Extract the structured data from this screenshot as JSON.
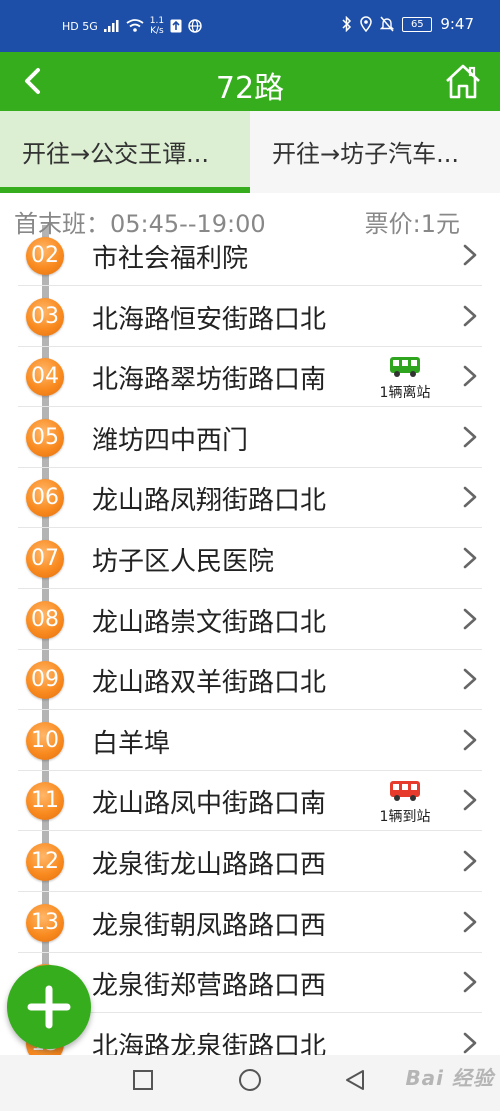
{
  "status_bar": {
    "network": "HD 5G",
    "speed_value": "1.1",
    "speed_unit": "K/s",
    "battery": "65",
    "time": "9:47"
  },
  "header": {
    "title": "72路",
    "back_icon": "chevron-left-icon",
    "home_icon": "home-icon"
  },
  "tabs": [
    {
      "label": "开往→公交王谭...",
      "active": true
    },
    {
      "label": "开往→坊子汽车...",
      "active": false
    }
  ],
  "info": {
    "schedule": "首末班：05:45--19:00",
    "price": "票价:1元"
  },
  "stops": [
    {
      "num": "02",
      "name": "市社会福利院"
    },
    {
      "num": "03",
      "name": "北海路恒安街路口北"
    },
    {
      "num": "04",
      "name": "北海路翠坊街路口南",
      "bus": {
        "label": "1辆离站",
        "color": "#2fa51f"
      }
    },
    {
      "num": "05",
      "name": "潍坊四中西门"
    },
    {
      "num": "06",
      "name": "龙山路凤翔街路口北"
    },
    {
      "num": "07",
      "name": "坊子区人民医院"
    },
    {
      "num": "08",
      "name": "龙山路崇文街路口北"
    },
    {
      "num": "09",
      "name": "龙山路双羊街路口北"
    },
    {
      "num": "10",
      "name": "白羊埠"
    },
    {
      "num": "11",
      "name": "龙山路凤中街路口南",
      "bus": {
        "label": "1辆到站",
        "color": "#e53a2c"
      }
    },
    {
      "num": "12",
      "name": "龙泉街龙山路路口西"
    },
    {
      "num": "13",
      "name": "龙泉街朝凤路路口西"
    },
    {
      "num": "14",
      "name": "龙泉街郑营路路口西"
    },
    {
      "num": "15",
      "name": "北海路龙泉街路口北"
    }
  ],
  "colors": {
    "primary_green": "#36ad1d",
    "status_blue": "#1e4fa8",
    "badge_orange": "#f98b20"
  },
  "watermark": "Bai 经验"
}
